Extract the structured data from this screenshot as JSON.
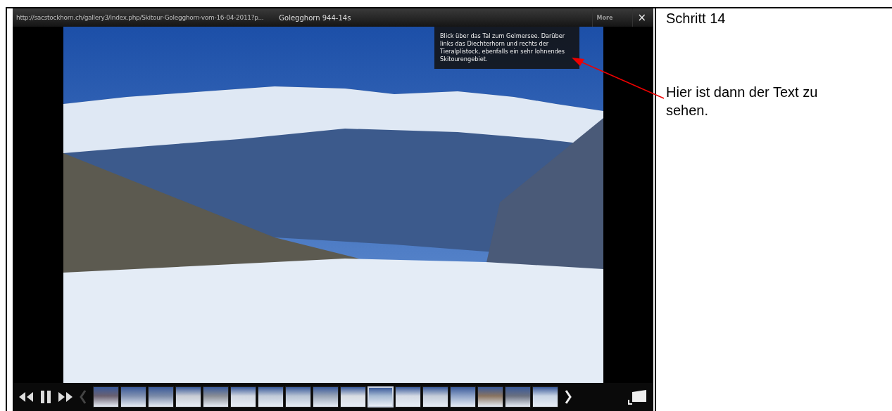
{
  "viewer": {
    "url": "http://sacstockhorn.ch/gallery3/index.php/Skitour-Golegghorn-vom-16-04-2011?p...",
    "title": "Golegghorn 944-14s",
    "more": "More",
    "close": "×",
    "caption": "Blick über das Tal zum Gelmersee. Darüber links das Diechterhorn und rechts der Tieralplistock, ebenfalls ein sehr lohnendes Skitourengebiet.",
    "thumbnails": [
      {
        "selected": false
      },
      {
        "selected": false
      },
      {
        "selected": false
      },
      {
        "selected": false
      },
      {
        "selected": false
      },
      {
        "selected": false
      },
      {
        "selected": false
      },
      {
        "selected": false
      },
      {
        "selected": false
      },
      {
        "selected": false
      },
      {
        "selected": true
      },
      {
        "selected": false
      },
      {
        "selected": false
      },
      {
        "selected": false
      },
      {
        "selected": false
      },
      {
        "selected": false
      },
      {
        "selected": false
      }
    ]
  },
  "notes": {
    "step": "Schritt 14",
    "explanation": "Hier ist dann der Text zu sehen."
  }
}
